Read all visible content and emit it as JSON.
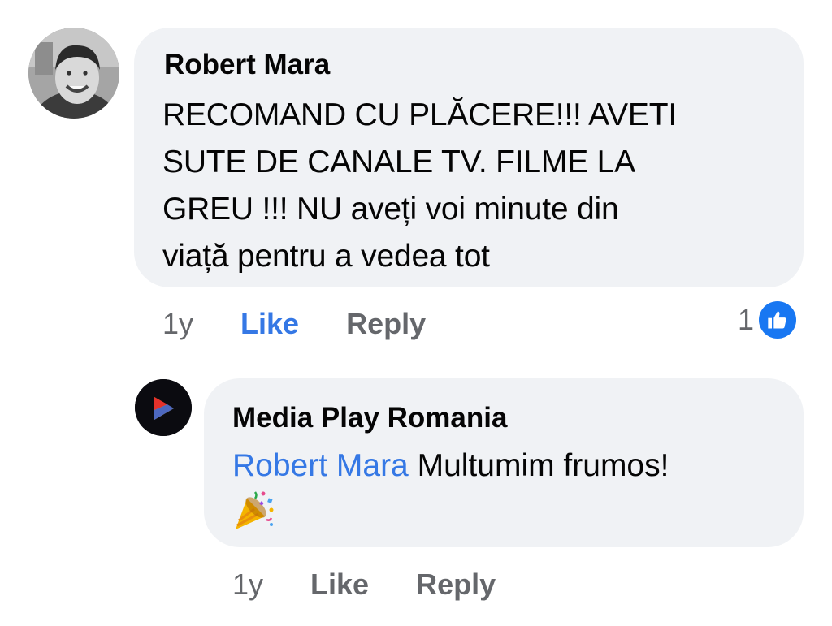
{
  "comment": {
    "author": "Robert Mara",
    "text": "RECOMAND CU PLĂCERE!!! AVETI\nSUTE DE CANALE TV. FILME LA\nGREU !!! NU aveți voi minute din\nviață pentru a vedea tot",
    "time": "1y",
    "like_label": "Like",
    "reply_label": "Reply",
    "reaction_count": "1",
    "reaction_icon": "thumbs-up-icon",
    "like_active_color": "#3578e5"
  },
  "reply": {
    "author": "Media Play Romania",
    "mention": "Robert Mara",
    "text": " Multumim frumos!",
    "emoji": "party-popper-icon",
    "time": "1y",
    "like_label": "Like",
    "reply_label": "Reply"
  },
  "colors": {
    "bubble": "#f0f2f5",
    "link": "#3578e5",
    "muted": "#65676b",
    "reaction_badge": "#1877f2"
  }
}
